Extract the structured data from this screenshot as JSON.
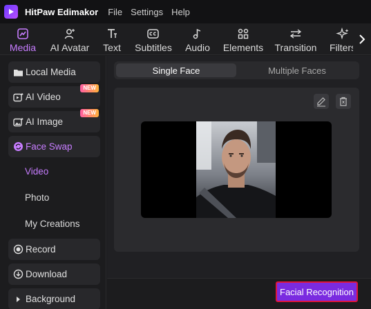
{
  "app": {
    "title": "HitPaw Edimakor"
  },
  "menu": [
    "File",
    "Settings",
    "Help"
  ],
  "tabs": [
    {
      "label": "Media",
      "icon": "media-icon",
      "active": true
    },
    {
      "label": "AI Avatar",
      "icon": "ai-avatar-icon",
      "active": false
    },
    {
      "label": "Text",
      "icon": "text-icon",
      "active": false
    },
    {
      "label": "Subtitles",
      "icon": "subtitles-icon",
      "active": false
    },
    {
      "label": "Audio",
      "icon": "audio-icon",
      "active": false
    },
    {
      "label": "Elements",
      "icon": "elements-icon",
      "active": false
    },
    {
      "label": "Transition",
      "icon": "transition-icon",
      "active": false
    },
    {
      "label": "Filters",
      "icon": "filters-icon",
      "active": false
    }
  ],
  "sidebar": {
    "items": [
      {
        "label": "Local Media",
        "icon": "folder-icon"
      },
      {
        "label": "AI Video",
        "icon": "ai-video-icon",
        "badge": "NEW"
      },
      {
        "label": "AI Image",
        "icon": "ai-image-icon",
        "badge": "NEW"
      },
      {
        "label": "Face Swap",
        "icon": "face-swap-icon",
        "active": true
      },
      {
        "label": "Record",
        "icon": "record-icon"
      },
      {
        "label": "Download",
        "icon": "download-icon"
      },
      {
        "label": "Background",
        "icon": "caret-right-icon"
      }
    ],
    "sub_items": [
      {
        "label": "Video",
        "active": true
      },
      {
        "label": "Photo"
      },
      {
        "label": "My Creations"
      }
    ]
  },
  "main": {
    "segments": [
      "Single Face",
      "Multiple Faces"
    ],
    "recognition_button": "Facial Recognition"
  },
  "colors": {
    "accent": "#c77dff",
    "button": "#7a2be0",
    "highlight": "#e0163d"
  }
}
